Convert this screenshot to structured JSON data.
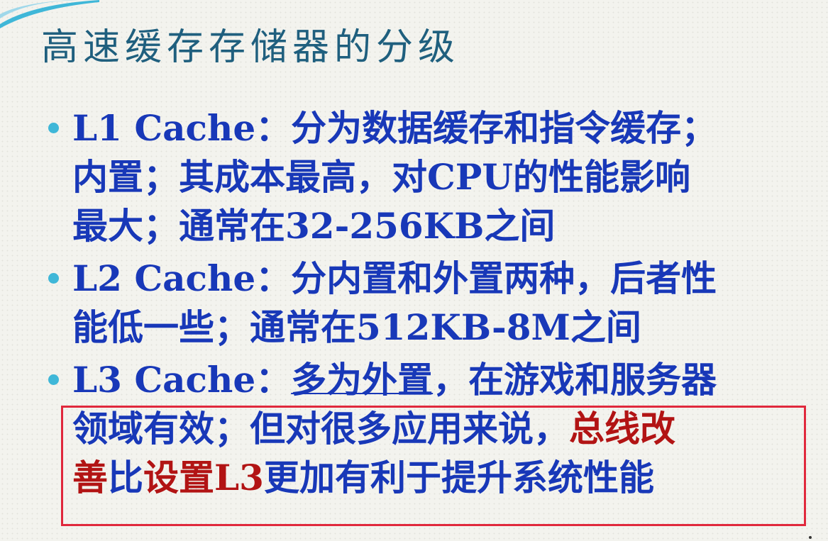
{
  "slide": {
    "title": "高速缓存存储器的分级",
    "bullets": [
      {
        "lines": [
          "L1 Cache：分为数据缓存和指令缓存；",
          "内置；其成本最高，对CPU的性能影响",
          "最大；通常在32-256KB之间"
        ]
      },
      {
        "lines": [
          "L2 Cache：分内置和外置两种，后者性",
          "能低一些；通常在512KB-8M之间"
        ]
      },
      {
        "line1_label": "L3 Cache",
        "line1_sep": "：",
        "line1_underlined": "多为外置",
        "line1_rest": "，在游戏和服务器",
        "line2_normal": "领域有效；但对很多应用来说，",
        "line2_red": "总线改",
        "line3_red1": "善",
        "line3_normal1": "比",
        "line3_red2": "设置L3",
        "line3_normal2": "更加有利于提升系统性能"
      }
    ]
  },
  "colors": {
    "title": "#1f5f7e",
    "body_text": "#1838b8",
    "emphasis": "#b21414",
    "bullet_dot": "#3fb7d8",
    "highlight_border": "#e0283c"
  }
}
